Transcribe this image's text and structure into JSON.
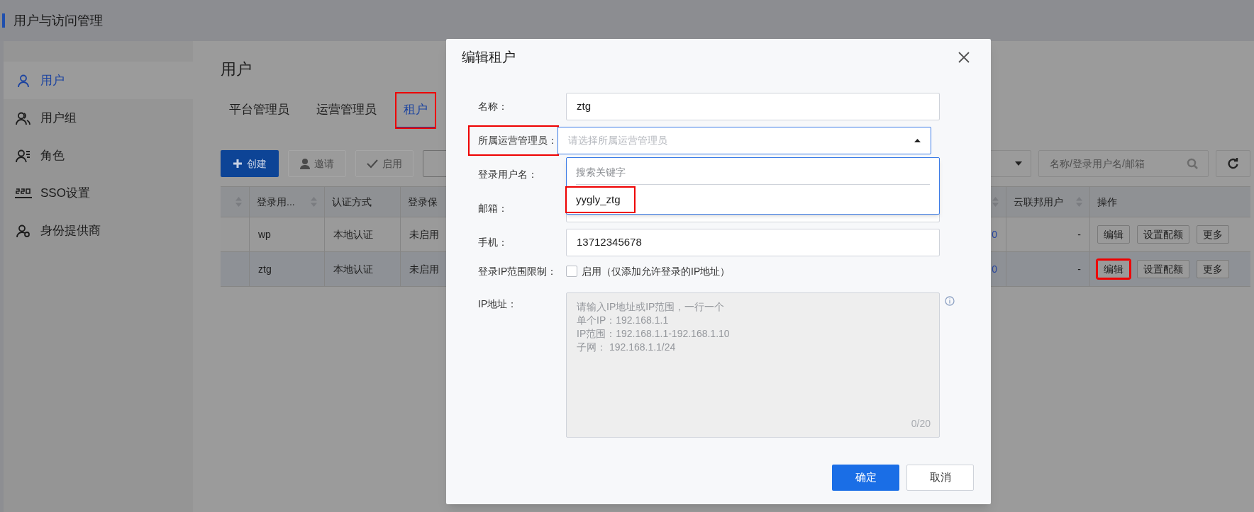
{
  "header": {
    "title": "用户与访问管理"
  },
  "sidebar": {
    "items": [
      {
        "label": "用户",
        "selected": true
      },
      {
        "label": "用户组",
        "selected": false
      },
      {
        "label": "角色",
        "selected": false
      },
      {
        "label": "SSO设置",
        "selected": false
      },
      {
        "label": "身份提供商",
        "selected": false
      }
    ]
  },
  "page_title": "用户",
  "tabs": [
    {
      "label": "平台管理员",
      "selected": false,
      "highlighted": false
    },
    {
      "label": "运营管理员",
      "selected": false,
      "highlighted": false
    },
    {
      "label": "租户",
      "selected": true,
      "highlighted": true
    }
  ],
  "toolbar": {
    "buttons": [
      {
        "kind": "primary",
        "label": "创建"
      },
      {
        "kind": "invite",
        "label": "邀请",
        "disabled": true
      },
      {
        "kind": "enable",
        "label": "启用",
        "disabled": true
      },
      {
        "kind": "ban",
        "disabled": false
      }
    ],
    "search": {
      "placeholder": "名称/登录用户名/邮箱"
    }
  },
  "table": {
    "columns": [
      {
        "sortable": true
      },
      {
        "label": "登录用...",
        "sortable": true
      },
      {
        "label": "认证方式",
        "sortable": false
      },
      {
        "label": "登录保",
        "sortable": false
      },
      {
        "sortable": true
      },
      {
        "label": "云联邦用户",
        "sortable": true
      },
      {
        "label": "操作",
        "sortable": false
      }
    ],
    "rows": [
      {
        "selected": false,
        "cells": [
          "",
          "wp",
          "本地认证",
          "未启用",
          "0",
          "-"
        ],
        "actions": [
          {
            "label": "编辑",
            "highlighted": false
          },
          {
            "label": "设置配额",
            "highlighted": false
          },
          {
            "label": "更多",
            "highlighted": false
          }
        ]
      },
      {
        "selected": true,
        "cells": [
          "",
          "ztg",
          "本地认证",
          "未启用",
          "0",
          "-"
        ],
        "actions": [
          {
            "label": "编辑",
            "highlighted": true
          },
          {
            "label": "设置配额",
            "highlighted": false
          },
          {
            "label": "更多",
            "highlighted": false
          }
        ]
      }
    ]
  },
  "dialog": {
    "title": "编辑租户",
    "fields": [
      {
        "kind": "text",
        "label": "名称：",
        "value": "ztg",
        "highlighted": false
      },
      {
        "kind": "select",
        "label": "所属运营管理员：",
        "placeholder": "请选择所属运营管理员",
        "open": true,
        "highlighted": true,
        "dropdown": {
          "search_placeholder": "搜索关键字",
          "options": [
            {
              "label": "yygly_ztg",
              "highlighted": true
            }
          ]
        }
      },
      {
        "kind": "text",
        "label": "登录用户名：",
        "highlighted": false
      },
      {
        "kind": "text",
        "label": "邮箱：",
        "highlighted": false
      },
      {
        "kind": "text",
        "label": "手机：",
        "value": "13712345678",
        "highlighted": false
      },
      {
        "kind": "checkbox",
        "label": "登录IP范围限制：",
        "text": "启用（仅添加允许登录的IP地址）",
        "checked": false,
        "highlighted": false
      },
      {
        "kind": "textarea",
        "label": "IP地址：",
        "placeholder_lines": [
          "请输入IP地址或IP范围，一行一个",
          "单个IP：192.168.1.1",
          "IP范围：192.168.1.1-192.168.1.10",
          "子网： 192.168.1.1/24"
        ],
        "counter": "0/20",
        "disabled": true,
        "highlighted": false
      }
    ],
    "buttons": [
      {
        "kind": "primary",
        "label": "确定"
      },
      {
        "kind": "default",
        "label": "取消"
      }
    ]
  }
}
